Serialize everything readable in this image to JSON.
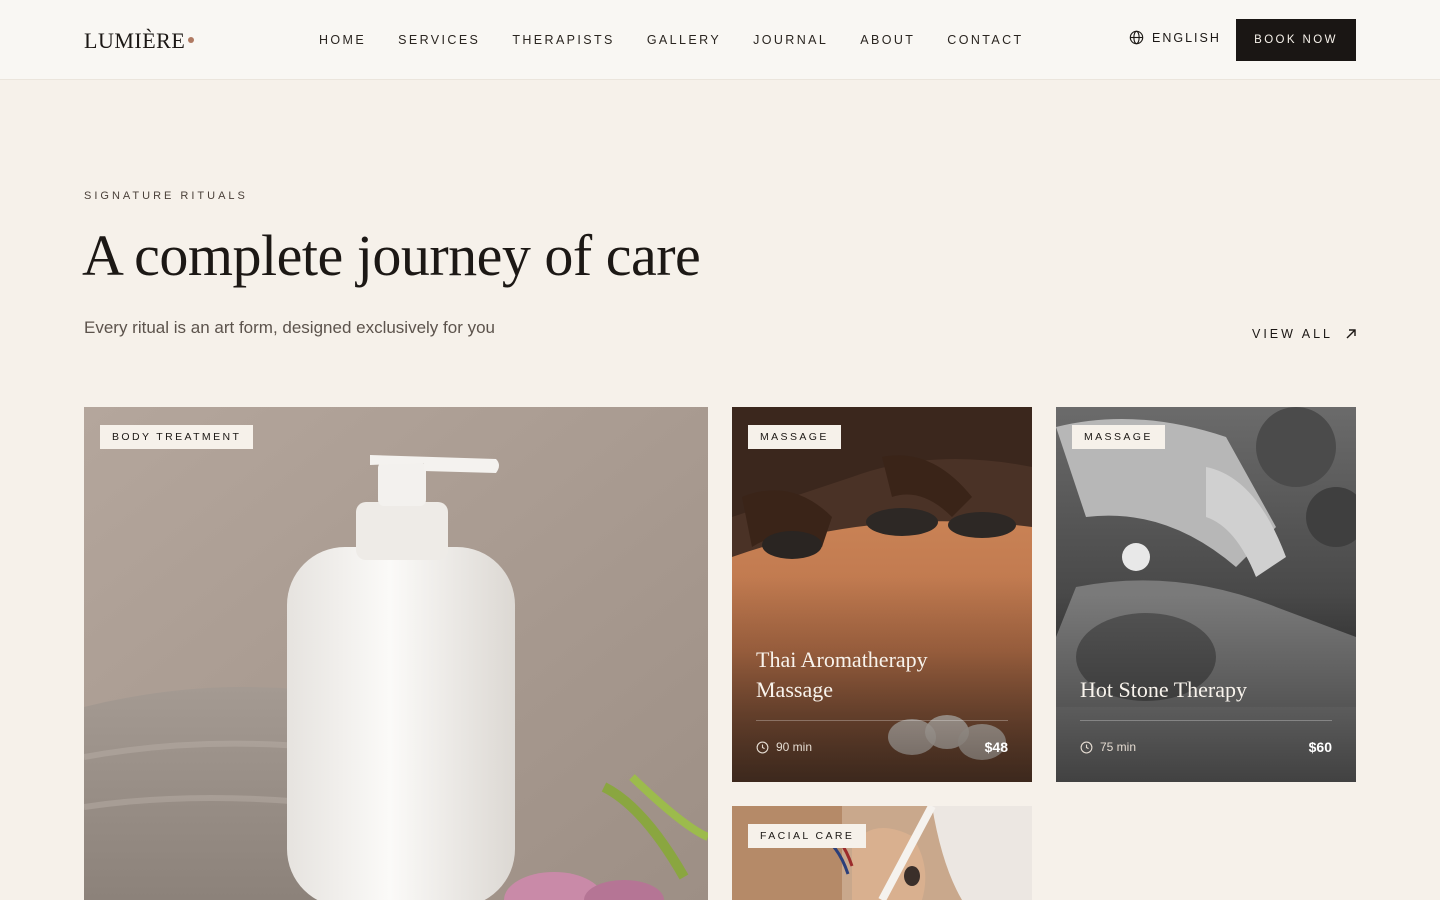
{
  "brand": {
    "logo": "LUMIÈRE",
    "accent_color": "#b07a62"
  },
  "nav": {
    "items": [
      "HOME",
      "SERVICES",
      "THERAPISTS",
      "GALLERY",
      "JOURNAL",
      "ABOUT",
      "CONTACT"
    ]
  },
  "header": {
    "language": "ENGLISH",
    "language_icon": "globe-icon",
    "book_label": "BOOK NOW"
  },
  "section": {
    "eyebrow": "SIGNATURE RITUALS",
    "title": "A complete journey of care",
    "subtitle": "Every ritual is an art form, designed exclusively for you",
    "view_all": "VIEW ALL",
    "view_all_icon": "arrow-up-right-icon"
  },
  "cards": [
    {
      "tag": "BODY TREATMENT",
      "image": "lotion-bottle-towel-photo"
    },
    {
      "tag": "MASSAGE",
      "title_line1": "Thai Aromatherapy",
      "title_line2": "Massage",
      "duration": "90 min",
      "price": "$48",
      "image": "hot-stones-back-photo"
    },
    {
      "tag": "MASSAGE",
      "title": "Hot Stone Therapy",
      "duration": "75 min",
      "price": "$60",
      "image": "massage-bw-photo"
    },
    {
      "tag": "FACIAL CARE",
      "image": "facial-brush-photo"
    }
  ]
}
